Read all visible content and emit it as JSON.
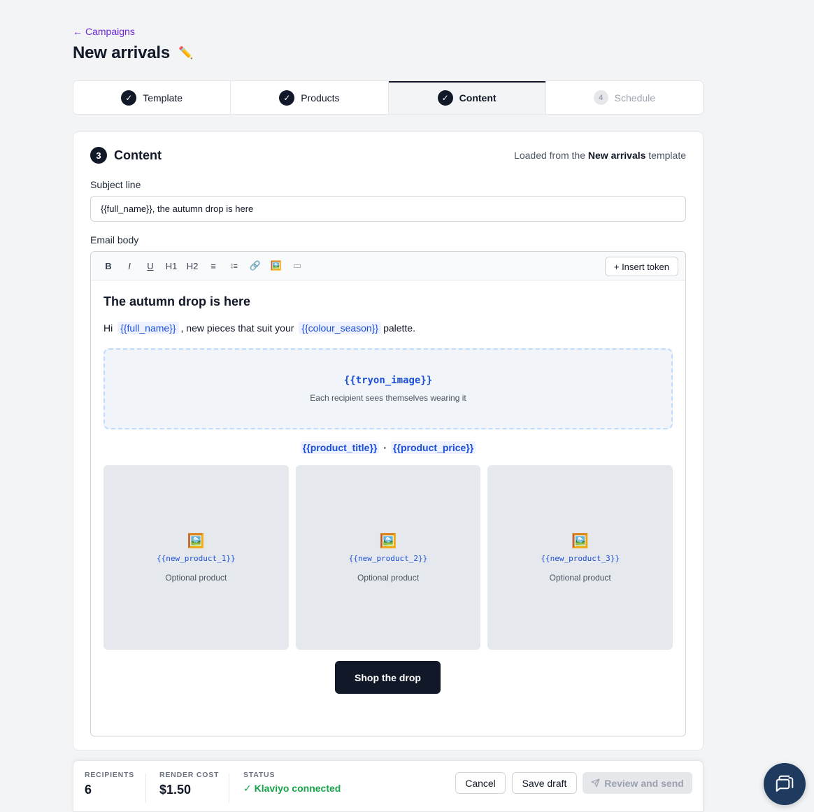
{
  "nav": {
    "back_arrow": "←",
    "back_label": "Campaigns"
  },
  "page": {
    "title": "New arrivals",
    "edit_icon": "✏️"
  },
  "steps": [
    {
      "label": "Template",
      "state": "done",
      "marker": "✓"
    },
    {
      "label": "Products",
      "state": "done",
      "marker": "✓"
    },
    {
      "label": "Content",
      "state": "active",
      "marker": "✓"
    },
    {
      "label": "Schedule",
      "state": "disabled",
      "marker": "4"
    }
  ],
  "section": {
    "number": "3",
    "title": "Content",
    "loaded_prefix": "Loaded from the",
    "loaded_template": "New arrivals",
    "loaded_suffix": "template"
  },
  "subject": {
    "label": "Subject line",
    "value": "{{full_name}}, the autumn drop is here"
  },
  "body": {
    "label": "Email body"
  },
  "toolbar": {
    "bold": "B",
    "italic": "I",
    "underline": "U",
    "h1": "H1",
    "h2": "H2",
    "bullet_list": "≡",
    "numbered_list": "⁝≡",
    "link": "🔗",
    "image": "🖼️",
    "button": "▭",
    "insert_token": "+ Insert token"
  },
  "email": {
    "heading": "The autumn drop is here",
    "p_hi": "Hi",
    "token_full_name": "{{full_name}}",
    "p_mid": ", new pieces that suit your",
    "token_colour": "{{colour_season}}",
    "p_end": "palette.",
    "tryon_token": "{{tryon_image}}",
    "tryon_sub": "Each recipient sees themselves wearing it",
    "product_title_token": "{{product_title}}",
    "separator": "·",
    "product_price_token": "{{product_price}}",
    "products": [
      {
        "icon": "🖼️",
        "token": "{{new_product_1}}",
        "sub": "Optional product"
      },
      {
        "icon": "🖼️",
        "token": "{{new_product_2}}",
        "sub": "Optional product"
      },
      {
        "icon": "🖼️",
        "token": "{{new_product_3}}",
        "sub": "Optional product"
      }
    ],
    "cta": "Shop the drop"
  },
  "footer": {
    "recipients_label": "RECIPIENTS",
    "recipients_value": "6",
    "cost_label": "RENDER COST",
    "cost_value": "$1.50",
    "status_label": "STATUS",
    "status_value": "✓ Klaviyo connected",
    "cancel": "Cancel",
    "save_draft": "Save draft",
    "review_send": "Review and send"
  },
  "colors": {
    "accent": "#6d28d9",
    "dark": "#111827",
    "token": "#1d4ed8",
    "success": "#16a34a",
    "fab": "#1e3a5f"
  }
}
